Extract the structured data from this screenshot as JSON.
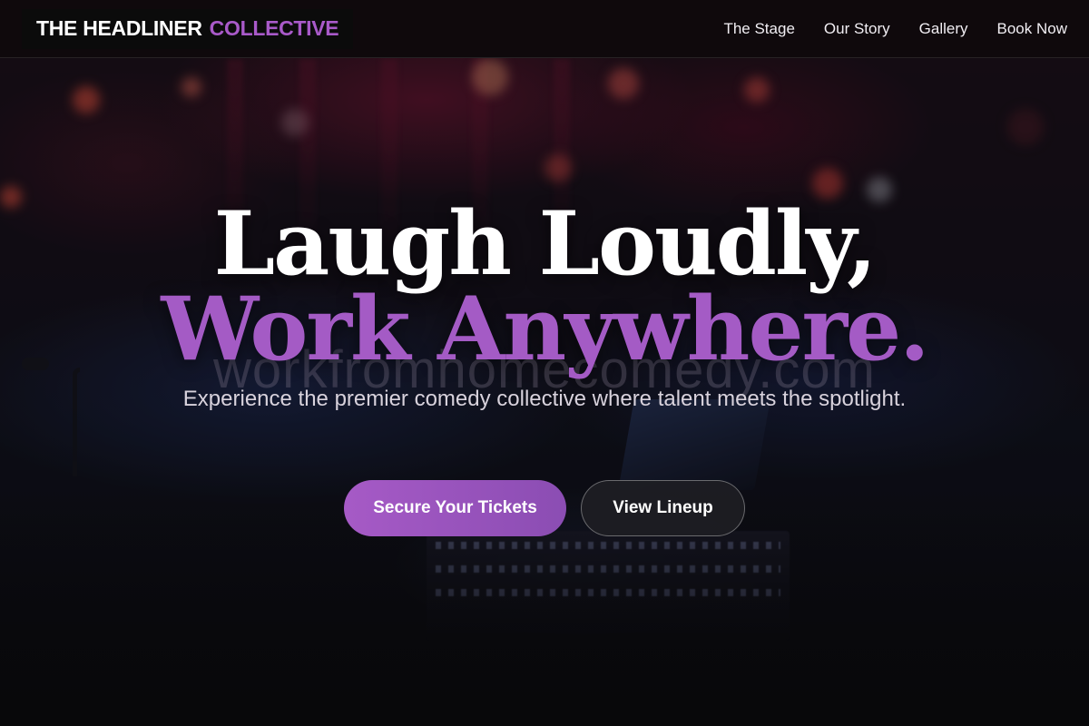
{
  "header": {
    "logo_main": "THE HEADLINER",
    "logo_accent": "COLLECTIVE",
    "nav": [
      {
        "label": "The Stage"
      },
      {
        "label": "Our Story"
      },
      {
        "label": "Gallery"
      },
      {
        "label": "Book Now"
      }
    ]
  },
  "hero": {
    "headline_line_1": "Laugh Loudly,",
    "headline_line_2": "Work Anywhere.",
    "watermark": "workfromhomecomedy.com",
    "subtitle": "Experience the premier comedy collective where talent meets the spotlight.",
    "primary_cta": "Secure Your Tickets",
    "secondary_cta": "View Lineup"
  },
  "colors": {
    "accent": "#a45bc5",
    "header_bg": "#0f090c",
    "text": "#ffffff"
  }
}
